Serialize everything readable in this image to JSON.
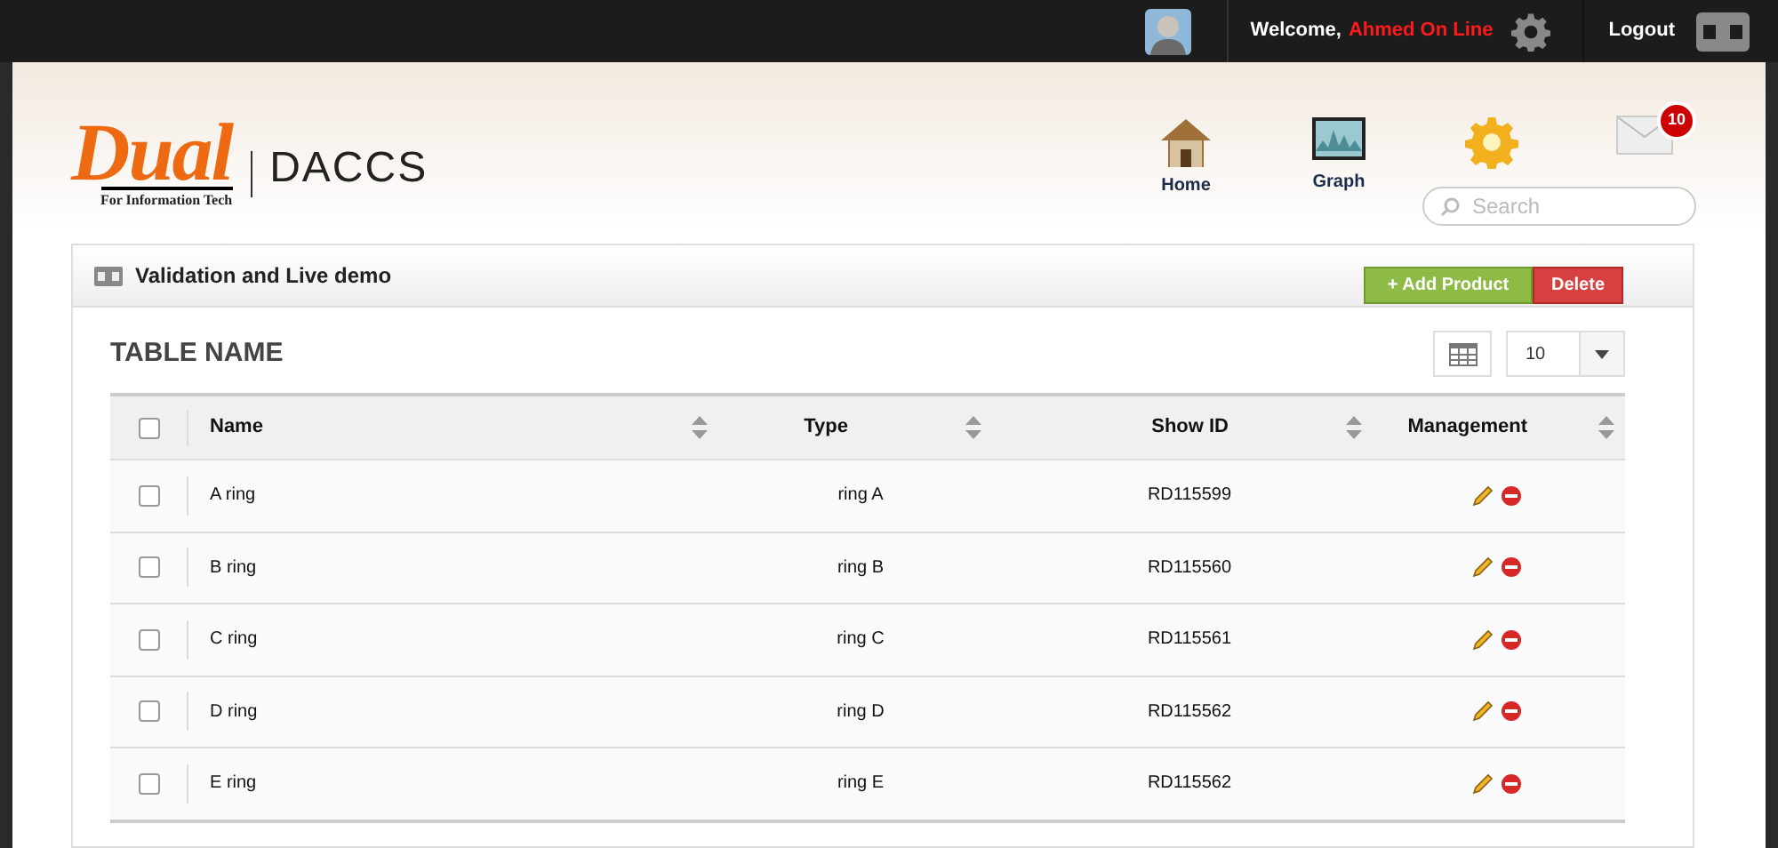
{
  "top_bar": {
    "welcome": "Welcome,",
    "user": "Ahmed On Line",
    "logout": "Logout"
  },
  "logo": {
    "brand": "Dual",
    "tagline": "For Information Tech",
    "product": "DACCS"
  },
  "nav": [
    {
      "label": "Home",
      "kind": "home"
    },
    {
      "label": "Graph",
      "kind": "graph"
    },
    {
      "kind": "settings"
    },
    {
      "kind": "mail",
      "badge": "10"
    }
  ],
  "search": {
    "placeholder": "Search"
  },
  "panel": {
    "title": "Validation and Live demo",
    "add_button": "+ Add Product",
    "delete_button": "Delete"
  },
  "table": {
    "name": "TABLE NAME",
    "page_size": "10",
    "all_checked": false,
    "columns": [
      "Name",
      "Type",
      "Show ID",
      "Management"
    ],
    "rows": [
      {
        "name": "A ring",
        "type": "ring A",
        "show_id": "RD115599",
        "checked": false
      },
      {
        "name": "B ring",
        "type": "ring B",
        "show_id": "RD115560",
        "checked": false
      },
      {
        "name": "C ring",
        "type": "ring C",
        "show_id": "RD115561",
        "checked": false
      },
      {
        "name": "D ring",
        "type": "ring D",
        "show_id": "RD115562",
        "checked": false
      },
      {
        "name": "E ring",
        "type": "ring E",
        "show_id": "RD115562",
        "checked": false
      }
    ]
  }
}
